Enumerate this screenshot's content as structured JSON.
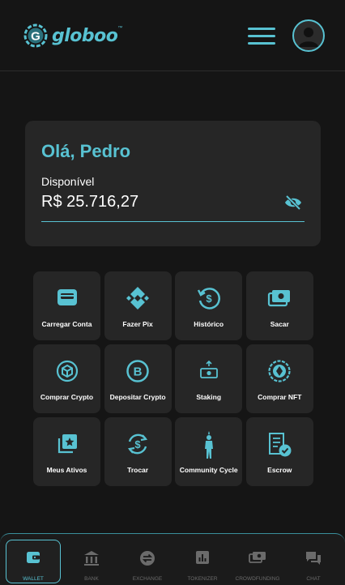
{
  "header": {
    "logo": {
      "letter": "G",
      "text": "globoo",
      "tm": "™"
    }
  },
  "balance": {
    "greeting": "Olá, Pedro",
    "label": "Disponível",
    "amount": "R$ 25.716,27"
  },
  "actions": [
    {
      "label": "Carregar Conta",
      "icon": "card-icon"
    },
    {
      "label": "Fazer Pix",
      "icon": "pix-icon"
    },
    {
      "label": "Histórico",
      "icon": "history-icon"
    },
    {
      "label": "Sacar",
      "icon": "cash-icon"
    },
    {
      "label": "Comprar Crypto",
      "icon": "crypto-cube-icon"
    },
    {
      "label": "Depositar Crypto",
      "icon": "bitcoin-icon"
    },
    {
      "label": "Staking",
      "icon": "staking-icon"
    },
    {
      "label": "Comprar NFT",
      "icon": "nft-coin-icon"
    },
    {
      "label": "Meus Ativos",
      "icon": "assets-star-icon"
    },
    {
      "label": "Trocar",
      "icon": "exchange-dollar-icon"
    },
    {
      "label": "Community Cycle",
      "icon": "person-icon"
    },
    {
      "label": "Escrow",
      "icon": "escrow-receipt-icon"
    }
  ],
  "bottom_nav": [
    {
      "label": "WALLET",
      "active": true
    },
    {
      "label": "BANK",
      "active": false
    },
    {
      "label": "EXCHANGE",
      "active": false
    },
    {
      "label": "TOKENIZER",
      "active": false
    },
    {
      "label": "CROWDFUNDING",
      "active": false
    },
    {
      "label": "CHAT",
      "active": false
    }
  ],
  "colors": {
    "accent": "#58c2d2",
    "background": "#151515",
    "card": "#262626",
    "nav_inactive": "#6b6b6b"
  }
}
